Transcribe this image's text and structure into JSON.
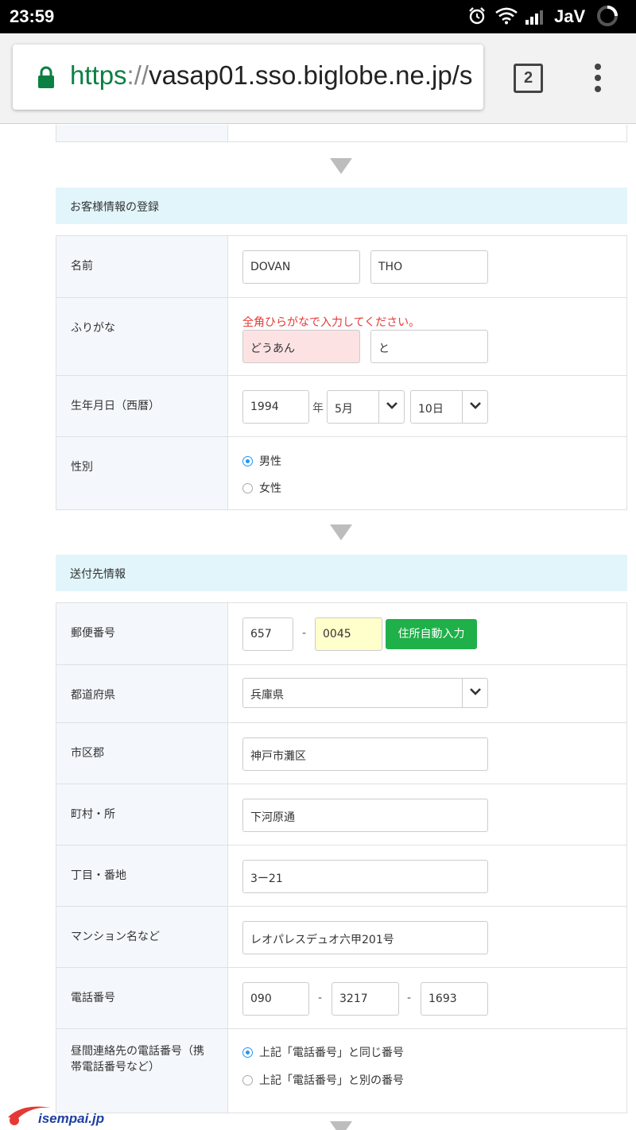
{
  "status_bar": {
    "time": "23:59",
    "carrier": "JaV",
    "icons": [
      "alarm-icon",
      "wifi-icon",
      "signal-icon",
      "loading-spinner-icon"
    ]
  },
  "browser": {
    "url_scheme": "https",
    "url_sep": "://",
    "url_host": "vasap01.sso.biglobe.ne.jp/s",
    "tab_count": "2",
    "lock_color": "#0b8043"
  },
  "customer_section": {
    "title": "お客様情報の登録",
    "name": {
      "label": "名前",
      "last": "DOVAN",
      "first": "THO"
    },
    "furigana": {
      "label": "ふりがな",
      "error": "全角ひらがなで入力してください。",
      "last": "どうあん",
      "first": "と"
    },
    "birthday": {
      "label": "生年月日（西暦）",
      "year": "1994",
      "year_unit": "年",
      "month": "5月",
      "day": "10日"
    },
    "gender": {
      "label": "性別",
      "options": [
        "男性",
        "女性"
      ],
      "selected": "男性"
    }
  },
  "shipping_section": {
    "title": "送付先情報",
    "postal": {
      "label": "郵便番号",
      "part1": "657",
      "dash": "-",
      "part2": "0045",
      "auto_button": "住所自動入力"
    },
    "prefecture": {
      "label": "都道府県",
      "value": "兵庫県"
    },
    "city": {
      "label": "市区郡",
      "value": "神戸市灘区"
    },
    "town": {
      "label": "町村・所",
      "value": "下河原通"
    },
    "block": {
      "label": "丁目・番地",
      "value": "3ー21"
    },
    "building": {
      "label": "マンション名など",
      "value": "レオパレスデュオ六甲201号"
    },
    "phone": {
      "label": "電話番号",
      "part1": "090",
      "part2": "3217",
      "part3": "1693",
      "dash": "-"
    },
    "daytime_phone": {
      "label": "昼間連絡先の電話番号（携帯電話番号など）",
      "options": [
        "上記「電話番号」と同じ番号",
        "上記「電話番号」と別の番号"
      ],
      "selected": "上記「電話番号」と同じ番号"
    }
  },
  "watermark": {
    "text": "isempai.jp"
  },
  "colors": {
    "section_header_bg": "#e1f5fb",
    "label_bg": "#f4f8fc",
    "error": "#e53935",
    "invalid_field_bg": "#fde2e4",
    "highlight_field_bg": "#ffffcc",
    "auto_fill_button": "#20b04a",
    "radio_accent": "#2196f3"
  }
}
